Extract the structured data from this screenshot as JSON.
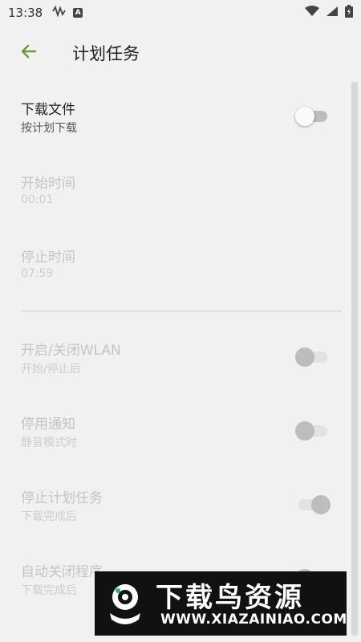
{
  "status_bar": {
    "time": "13:38",
    "left_icons": [
      "signal-wave-icon",
      "a-square-icon"
    ],
    "right_icons": [
      "wifi-icon",
      "cellular-icon",
      "battery-charging-icon"
    ],
    "notif_letter": "A"
  },
  "app_bar": {
    "title": "计划任务",
    "back_icon": "arrow-left-icon",
    "accent": "#6a9a3c"
  },
  "preferences": [
    {
      "title": "下载文件",
      "summary": "按计划下载",
      "switch": "off",
      "enabled": true
    },
    {
      "title": "开始时间",
      "summary": "00:01",
      "enabled": false
    },
    {
      "title": "停止时间",
      "summary": "07:59",
      "enabled": false
    },
    {
      "title": "开启/关闭WLAN",
      "summary": "开始/停止后",
      "switch": "off",
      "enabled": false
    },
    {
      "title": "停用通知",
      "summary": "静音模式时",
      "switch": "off",
      "enabled": false
    },
    {
      "title": "停止计划任务",
      "summary": "下载完成后",
      "switch": "on",
      "enabled": false
    },
    {
      "title": "自动关闭程序",
      "summary": "下载完成后",
      "switch": "off",
      "enabled": false
    }
  ],
  "watermark": {
    "name": "下载鸟资源",
    "url": "WWW.XIAZAINIAO.COM"
  }
}
